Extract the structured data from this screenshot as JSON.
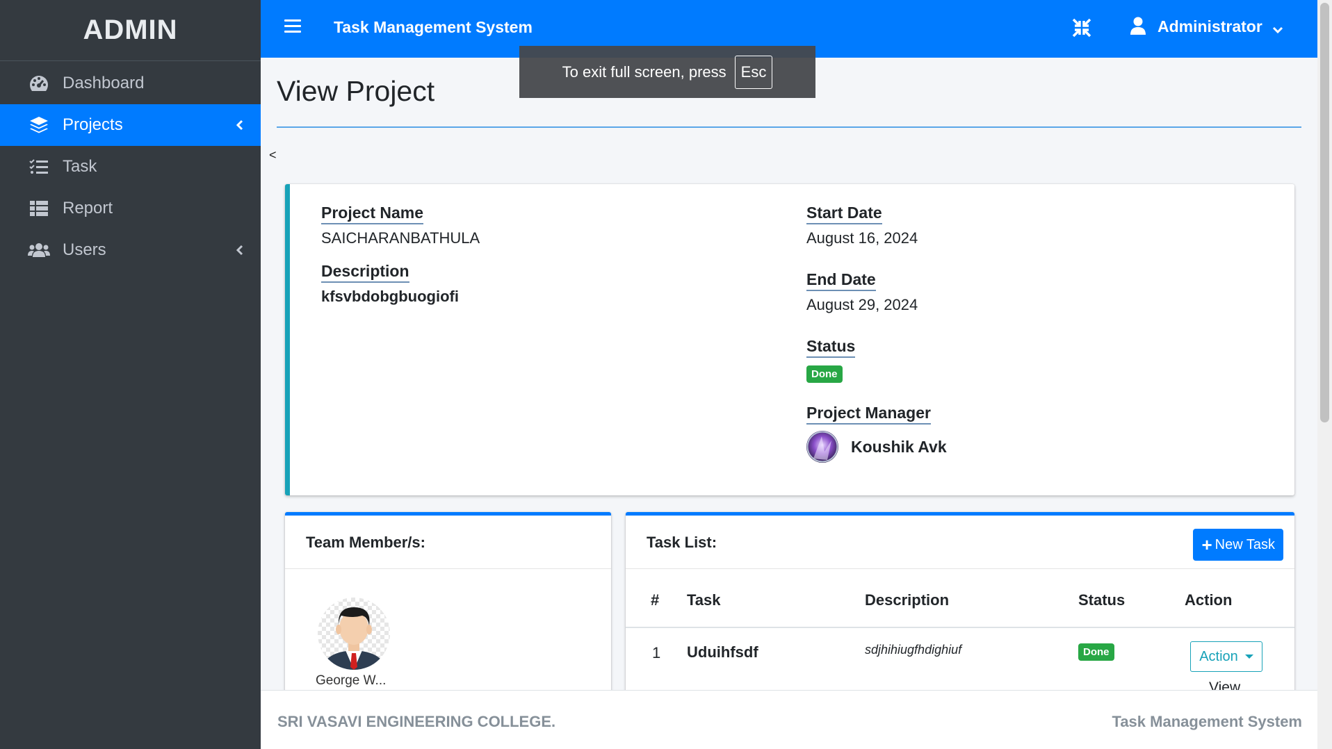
{
  "sidebar": {
    "brand": "ADMIN",
    "items": [
      {
        "label": "Dashboard",
        "icon": "tachometer-icon"
      },
      {
        "label": "Projects",
        "icon": "layers-icon",
        "active": true
      },
      {
        "label": "Task",
        "icon": "tasks-icon"
      },
      {
        "label": "Report",
        "icon": "table-icon"
      },
      {
        "label": "Users",
        "icon": "users-icon"
      }
    ]
  },
  "topbar": {
    "title": "Task Management System",
    "user": "Administrator"
  },
  "toast": {
    "message": "To exit full screen, press",
    "key": "Esc"
  },
  "page": {
    "title": "View Project",
    "back": "<"
  },
  "project": {
    "name_label": "Project Name",
    "name": "SAICHARANBATHULA",
    "description_label": "Description",
    "description": "kfsvbdobgbuogiofi",
    "start_label": "Start Date",
    "start": "August 16, 2024",
    "end_label": "End Date",
    "end": "August 29, 2024",
    "status_label": "Status",
    "status": "Done",
    "manager_label": "Project Manager",
    "manager": "Koushik Avk"
  },
  "team": {
    "title": "Team Member/s:",
    "members": [
      {
        "name": "George W..."
      }
    ]
  },
  "tasks": {
    "title": "Task List:",
    "new_button": "New Task",
    "columns": [
      "#",
      "Task",
      "Description",
      "Status",
      "Action"
    ],
    "rows": [
      {
        "num": "1",
        "task": "Uduihfsdf",
        "description": "sdjhihiugfhdighiuf",
        "status": "Done",
        "action": "Action",
        "link": "View"
      }
    ]
  },
  "footer": {
    "left": "SRI VASAVI ENGINEERING COLLEGE.",
    "right": "Task Management System"
  },
  "colors": {
    "primary": "#007bff",
    "sidebar": "#343a40",
    "success": "#28a745",
    "info": "#17a2b8"
  }
}
